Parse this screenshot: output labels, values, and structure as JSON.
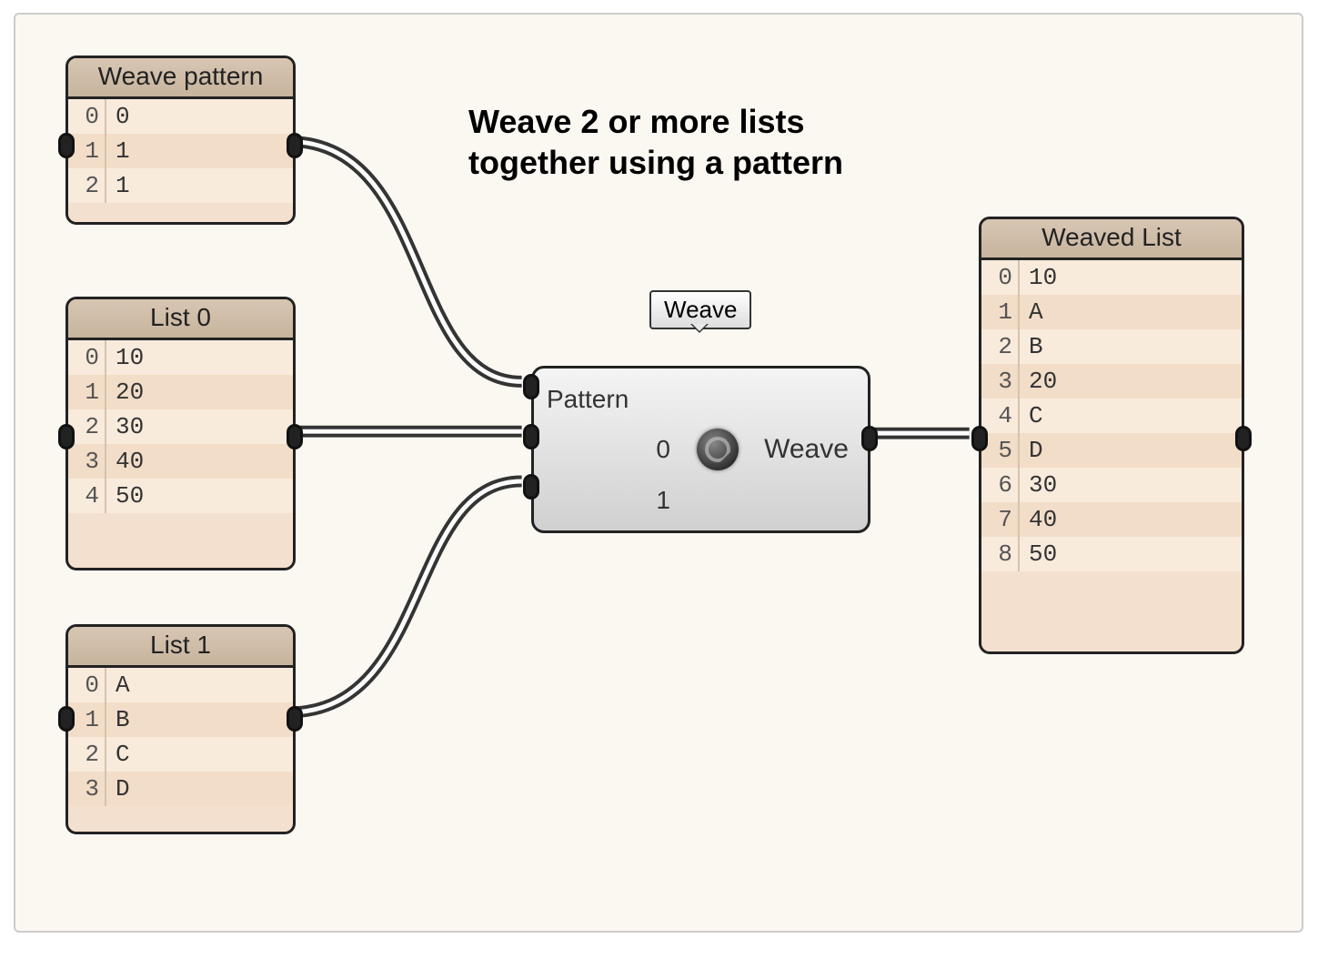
{
  "title": "Weave 2 or more lists\ntogether using a pattern",
  "node": {
    "tooltip": "Weave",
    "inputs": [
      "Pattern",
      "0",
      "1"
    ],
    "output": "Weave"
  },
  "panels": {
    "pattern": {
      "title": "Weave pattern",
      "rows": [
        "0",
        "1",
        "1"
      ]
    },
    "list0": {
      "title": "List 0",
      "rows": [
        "10",
        "20",
        "30",
        "40",
        "50"
      ]
    },
    "list1": {
      "title": "List 1",
      "rows": [
        "A",
        "B",
        "C",
        "D"
      ]
    },
    "output": {
      "title": "Weaved List",
      "rows": [
        "10",
        "A",
        "B",
        "20",
        "C",
        "D",
        "30",
        "40",
        "50"
      ]
    }
  }
}
